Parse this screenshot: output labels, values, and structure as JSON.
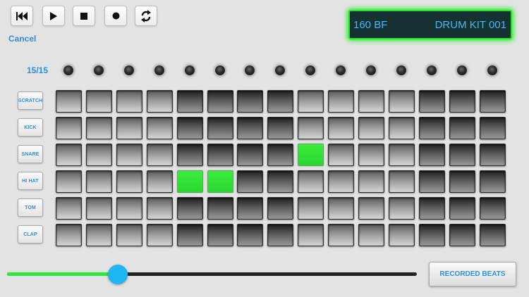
{
  "transport": {
    "buttons": [
      {
        "name": "skip-back-button",
        "icon": "skip-back-icon"
      },
      {
        "name": "play-button",
        "icon": "play-icon"
      },
      {
        "name": "stop-button",
        "icon": "stop-icon"
      },
      {
        "name": "record-button",
        "icon": "record-icon"
      },
      {
        "name": "loop-button",
        "icon": "loop-arrows-icon"
      }
    ],
    "cancel_label": "Cancel"
  },
  "display": {
    "tempo": "160 BF",
    "kit": "DRUM KIT 001"
  },
  "sequencer": {
    "step_count": "15/15",
    "steps": 15,
    "tracks": [
      {
        "label": "SCRATCH",
        "active": []
      },
      {
        "label": "KICK",
        "active": []
      },
      {
        "label": "SNARE",
        "active": [
          8
        ]
      },
      {
        "label": "HI HAT",
        "active": [
          4,
          5
        ]
      },
      {
        "label": "TOM",
        "active": []
      },
      {
        "label": "CLAP",
        "active": []
      }
    ]
  },
  "slider": {
    "value": 0.27
  },
  "recorded_beats_label": "RECORDED BEATS",
  "colors": {
    "accent_blue": "#2f8fd8",
    "active_green": "#2cf030",
    "display_bg": "#163131",
    "thumb_blue": "#1fb4f2"
  }
}
